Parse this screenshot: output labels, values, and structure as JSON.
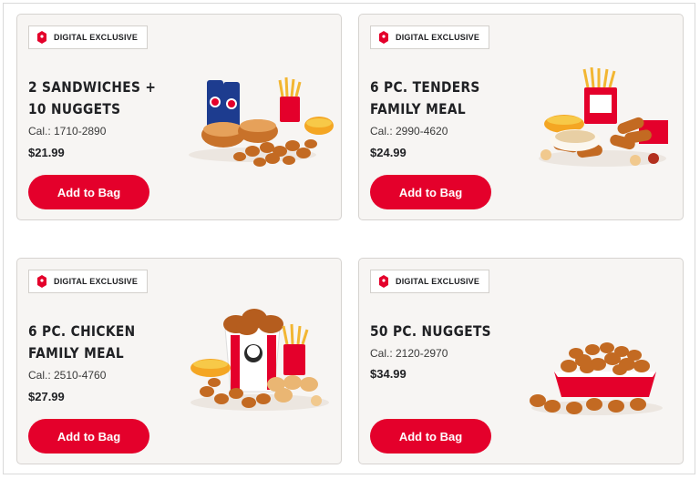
{
  "badge_label": "DIGITAL EXCLUSIVE",
  "colors": {
    "brand_red": "#e4002b",
    "card_bg": "#f7f5f3"
  },
  "offers": [
    {
      "title": "2 SANDWICHES + 10 NUGGETS",
      "calories": "Cal.: 1710-2890",
      "price": "$21.99",
      "button": "Add to Bag",
      "image": "sandwiches-nuggets-meal-image"
    },
    {
      "title": "6 PC. TENDERS FAMILY MEAL",
      "calories": "Cal.: 2990-4620",
      "price": "$24.99",
      "button": "Add to Bag",
      "image": "tenders-family-meal-image"
    },
    {
      "title": "6 PC. CHICKEN FAMILY MEAL",
      "calories": "Cal.: 2510-4760",
      "price": "$27.99",
      "button": "Add to Bag",
      "image": "chicken-family-meal-image"
    },
    {
      "title": "50 PC. NUGGETS",
      "calories": "Cal.: 2120-2970",
      "price": "$34.99",
      "button": "Add to Bag",
      "image": "nuggets-box-image"
    }
  ]
}
